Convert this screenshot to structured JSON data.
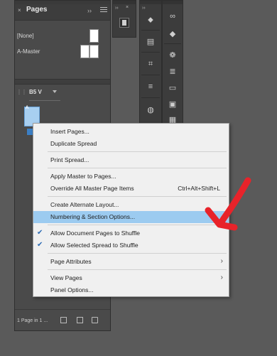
{
  "pages_panel": {
    "tab_label": "Pages",
    "masters": [
      {
        "label": "[None]"
      },
      {
        "label": "A-Master"
      }
    ],
    "page_size": "B5 V",
    "page_marker": "A",
    "footer_status": "1 Page in 1 ...",
    "collapse_glyph": "››",
    "close_glyph": "×"
  },
  "context_menu": {
    "items": [
      {
        "label": "Insert Pages..."
      },
      {
        "label": "Duplicate Spread"
      },
      {
        "label": "Print Spread..."
      },
      {
        "label": "Apply Master to Pages..."
      },
      {
        "label": "Override All Master Page Items",
        "shortcut": "Ctrl+Alt+Shift+L"
      },
      {
        "label": "Create Alternate Layout..."
      },
      {
        "label": "Numbering & Section Options...",
        "highlighted": true
      },
      {
        "label": "Allow Document Pages to Shuffle",
        "checked": true
      },
      {
        "label": "Allow Selected Spread to Shuffle",
        "checked": true
      },
      {
        "label": "Page Attributes",
        "submenu": true
      },
      {
        "label": "View Pages",
        "submenu": true
      },
      {
        "label": "Panel Options..."
      }
    ]
  },
  "colors": {
    "highlight": "#9ccbf0",
    "check": "#2d6cb5",
    "annotation": "#e8232a",
    "page_thumb": "#a8cff0"
  },
  "icons": {
    "check": "✔",
    "submenu": "›"
  }
}
